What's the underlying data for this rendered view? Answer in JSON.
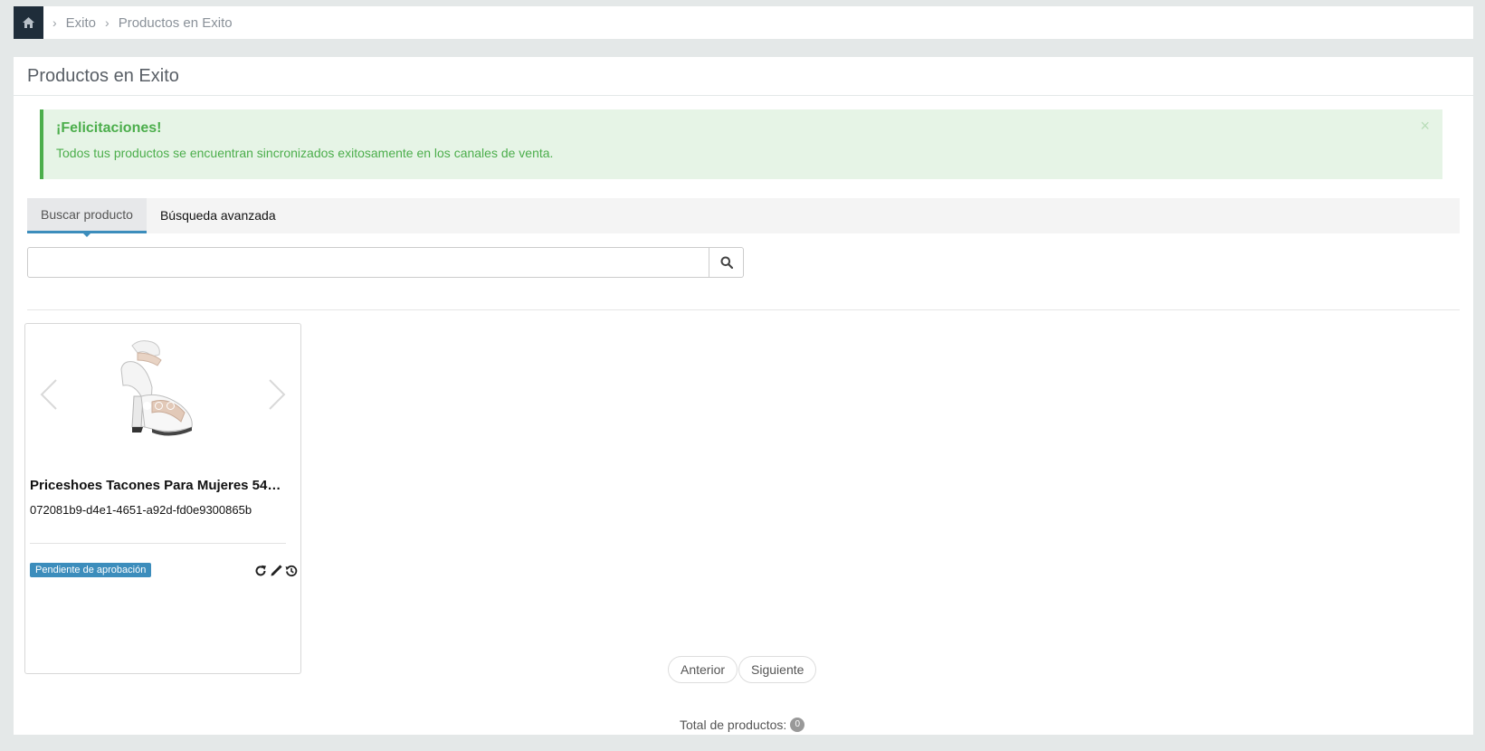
{
  "breadcrumb": {
    "home_icon": "home-icon",
    "items": [
      "Exito",
      "Productos en Exito"
    ]
  },
  "panel": {
    "title": "Productos en Exito"
  },
  "alert": {
    "title": "¡Felicitaciones!",
    "message": "Todos tus productos se encuentran sincronizados exitosamente en los canales de venta.",
    "close": "×",
    "color": "#4cae4c"
  },
  "tabs": [
    {
      "label": "Buscar producto",
      "active": true
    },
    {
      "label": "Búsqueda avanzada",
      "active": false
    }
  ],
  "search": {
    "value": "",
    "placeholder": "",
    "icon": "search-icon"
  },
  "products": [
    {
      "name": "Priceshoes Tacones Para Mujeres 54…",
      "id": "072081b9-d4e1-4651-a92d-fd0e9300865b",
      "status": "Pendiente de aprobación",
      "status_color": "#3c8dbc",
      "image_slides": 3,
      "active_slide": 1,
      "actions": [
        "refresh-icon",
        "pencil-icon",
        "history-icon"
      ]
    }
  ],
  "pager": {
    "prev": "Anterior",
    "next": "Siguiente"
  },
  "total": {
    "label": "Total de productos:",
    "count": "0"
  }
}
